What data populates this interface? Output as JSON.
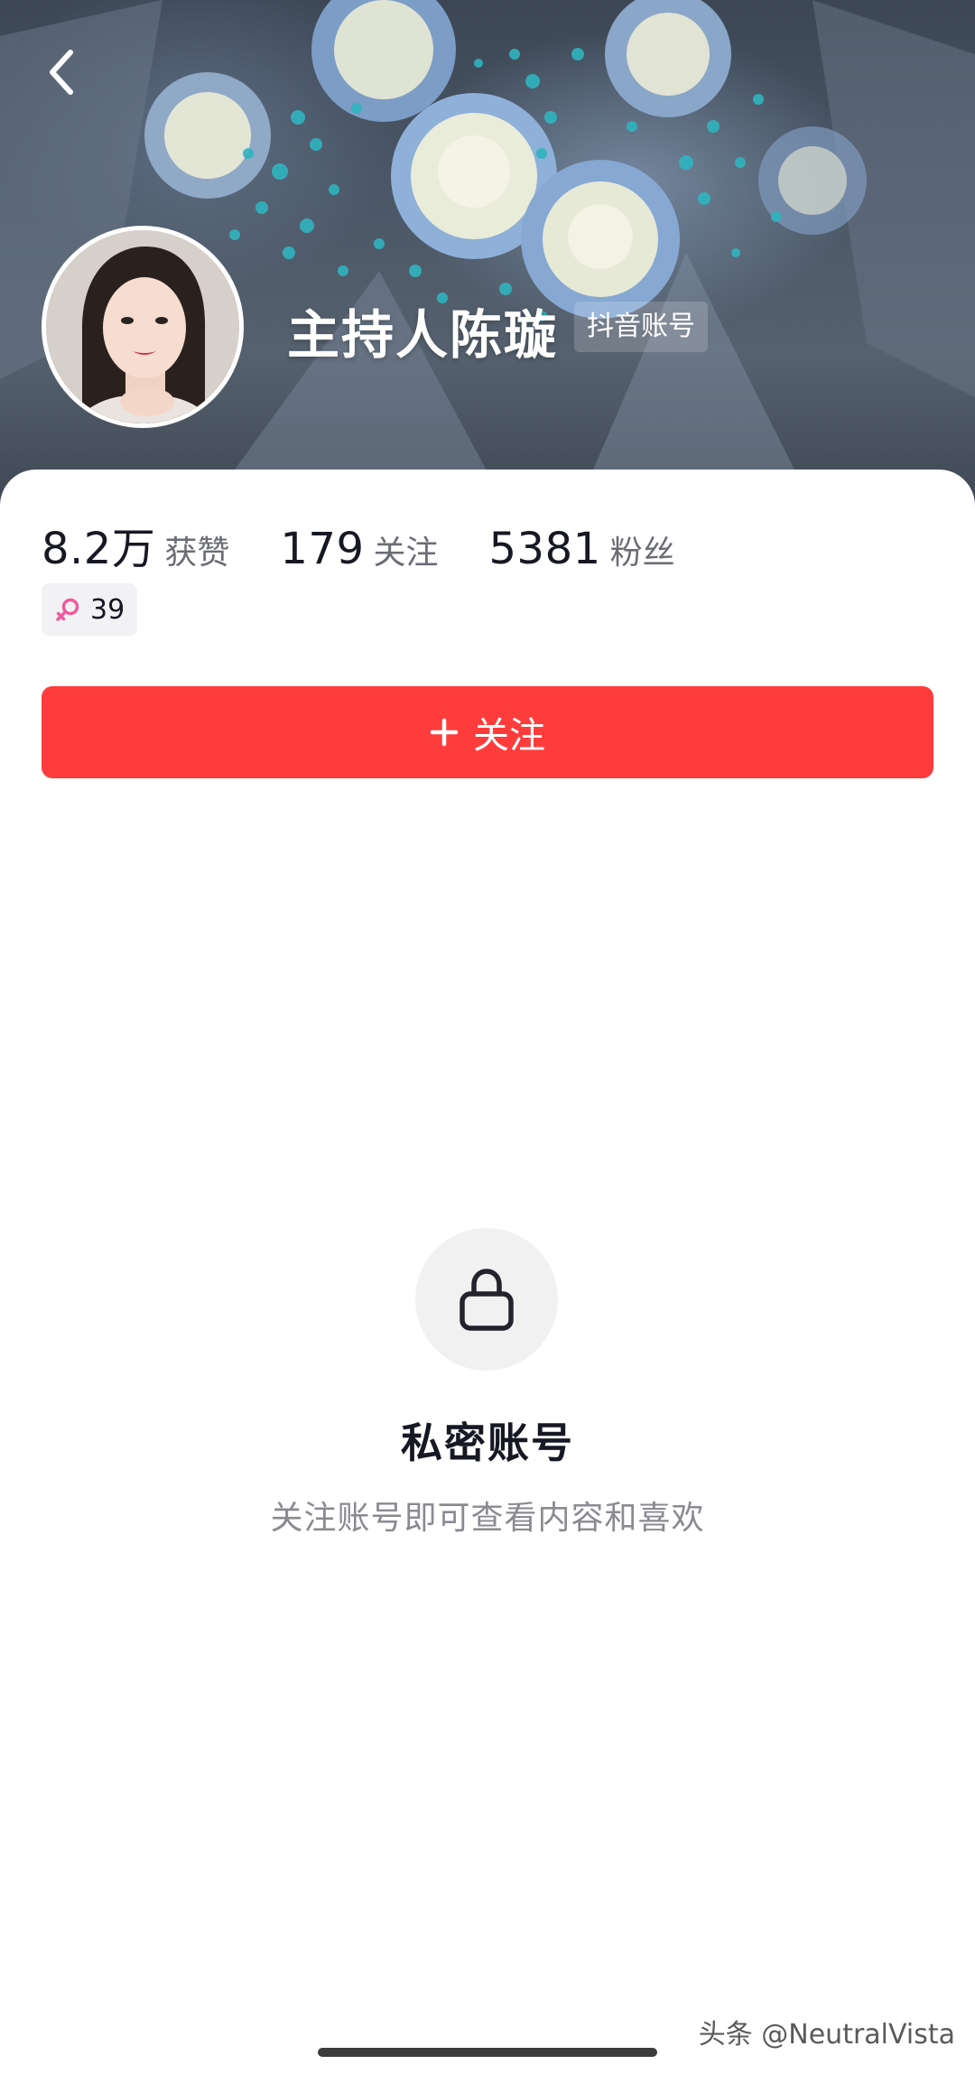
{
  "header": {
    "back_icon": "chevron-left-icon",
    "name": "主持人陈璇",
    "account_tag": "抖音账号"
  },
  "stats": {
    "likes": {
      "value": "8.2万",
      "label": "获赞"
    },
    "following": {
      "value": "179",
      "label": "关注"
    },
    "followers": {
      "value": "5381",
      "label": "粉丝"
    }
  },
  "badge": {
    "icon": "female-icon",
    "age": "39",
    "color": "#f05aa0"
  },
  "follow_button": {
    "label": "关注",
    "icon": "plus-icon",
    "color": "#fe3c3c"
  },
  "private": {
    "icon": "lock-icon",
    "title": "私密账号",
    "subtitle": "关注账号即可查看内容和喜欢"
  },
  "watermark": "头条 @NeutralVista"
}
